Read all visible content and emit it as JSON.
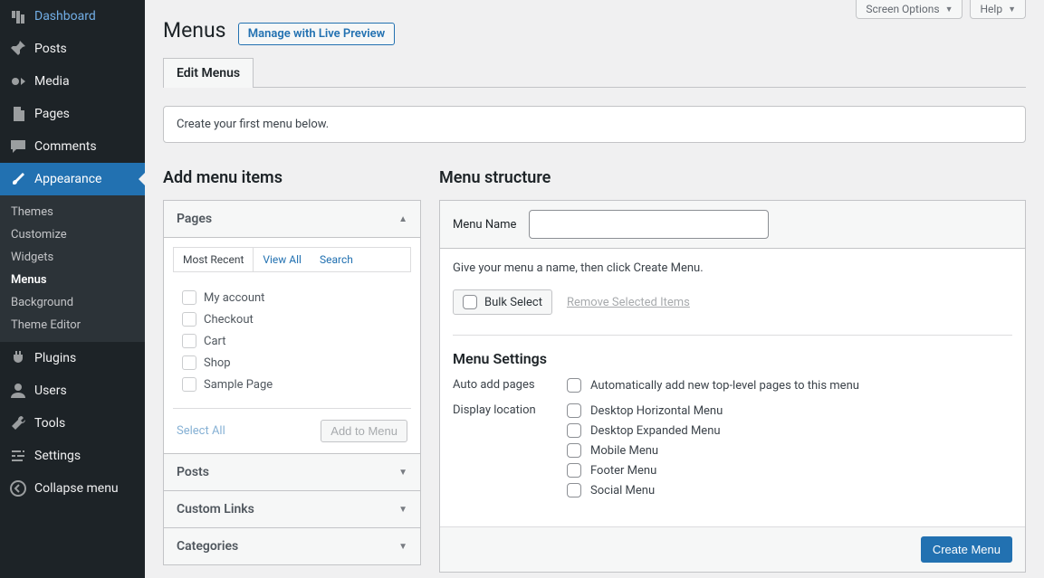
{
  "top_buttons": {
    "screen_options": "Screen Options",
    "help": "Help"
  },
  "page_title": "Menus",
  "live_preview_btn": "Manage with Live Preview",
  "tabs": {
    "edit": "Edit Menus"
  },
  "notice": "Create your first menu below.",
  "sidebar": {
    "items": [
      {
        "label": "Dashboard"
      },
      {
        "label": "Posts"
      },
      {
        "label": "Media"
      },
      {
        "label": "Pages"
      },
      {
        "label": "Comments"
      },
      {
        "label": "Appearance"
      },
      {
        "label": "Plugins"
      },
      {
        "label": "Users"
      },
      {
        "label": "Tools"
      },
      {
        "label": "Settings"
      },
      {
        "label": "Collapse menu"
      }
    ],
    "appearance_sub": [
      {
        "label": "Themes"
      },
      {
        "label": "Customize"
      },
      {
        "label": "Widgets"
      },
      {
        "label": "Menus"
      },
      {
        "label": "Background"
      },
      {
        "label": "Theme Editor"
      }
    ]
  },
  "left": {
    "heading": "Add menu items",
    "accordions": {
      "pages": "Pages",
      "posts": "Posts",
      "custom_links": "Custom Links",
      "categories": "Categories"
    },
    "page_tabs": {
      "recent": "Most Recent",
      "all": "View All",
      "search": "Search"
    },
    "page_items": [
      {
        "label": "My account"
      },
      {
        "label": "Checkout"
      },
      {
        "label": "Cart"
      },
      {
        "label": "Shop"
      },
      {
        "label": "Sample Page"
      }
    ],
    "select_all": "Select All",
    "add_to_menu": "Add to Menu"
  },
  "right": {
    "heading": "Menu structure",
    "menu_name_label": "Menu Name",
    "menu_name_value": "",
    "hint": "Give your menu a name, then click Create Menu.",
    "bulk_select": "Bulk Select",
    "remove_selected": "Remove Selected Items",
    "settings_heading": "Menu Settings",
    "auto_add_label": "Auto add pages",
    "auto_add_opt": "Automatically add new top-level pages to this menu",
    "display_loc_label": "Display location",
    "locations": [
      {
        "label": "Desktop Horizontal Menu"
      },
      {
        "label": "Desktop Expanded Menu"
      },
      {
        "label": "Mobile Menu"
      },
      {
        "label": "Footer Menu"
      },
      {
        "label": "Social Menu"
      }
    ],
    "create_btn": "Create Menu"
  }
}
